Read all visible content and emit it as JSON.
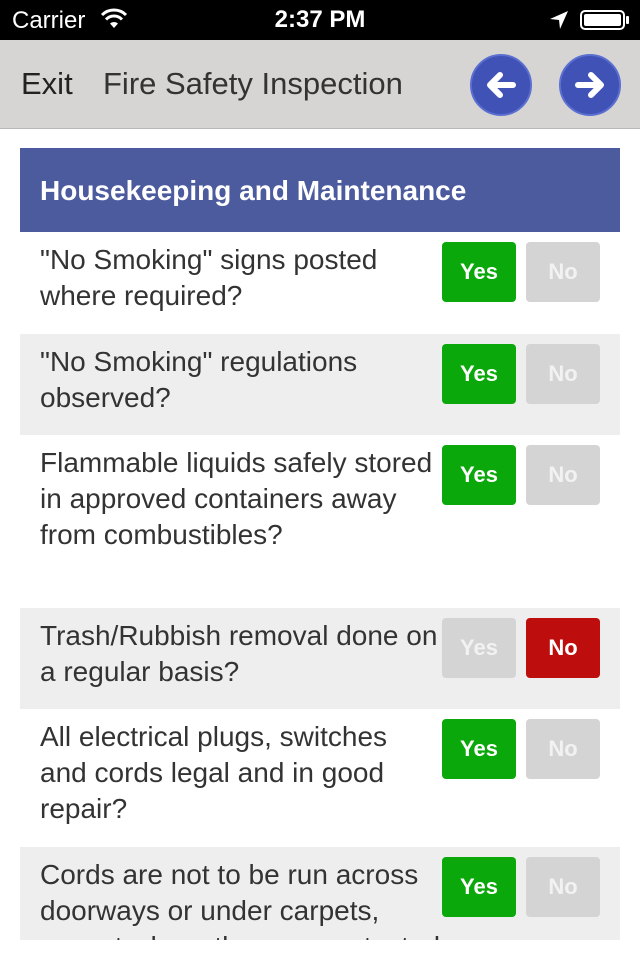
{
  "status_bar": {
    "carrier": "Carrier",
    "time": "2:37 PM",
    "icons": [
      "wifi-icon",
      "location-arrow-icon",
      "battery-icon"
    ]
  },
  "nav": {
    "exit_label": "Exit",
    "title": "Fire Safety Inspection",
    "back_icon": "arrow-left-icon",
    "forward_icon": "arrow-right-icon",
    "accent_color": "#4052b6"
  },
  "section": {
    "title": "Housekeeping and Maintenance",
    "color": "#4c5a9e"
  },
  "yes_label": "Yes",
  "no_label": "No",
  "colors": {
    "yes_selected": "#0aa80a",
    "no_selected": "#bd0d0d",
    "unselected": "#d4d4d4"
  },
  "questions": [
    {
      "text": "\"No Smoking\" signs posted where required?",
      "answer": "yes"
    },
    {
      "text": "\"No Smoking\" regulations observed?",
      "answer": "yes"
    },
    {
      "text": "Flammable liquids safely stored in approved containers away from combustibles?",
      "answer": "yes"
    },
    {
      "text": "Trash/Rubbish removal done on a regular basis?",
      "answer": "no"
    },
    {
      "text": "All electrical plugs, switches and cords legal and in good repair?",
      "answer": "yes"
    },
    {
      "text": "Cords are not to be run across doorways or under carpets, except where they are protected",
      "answer": "yes"
    }
  ]
}
